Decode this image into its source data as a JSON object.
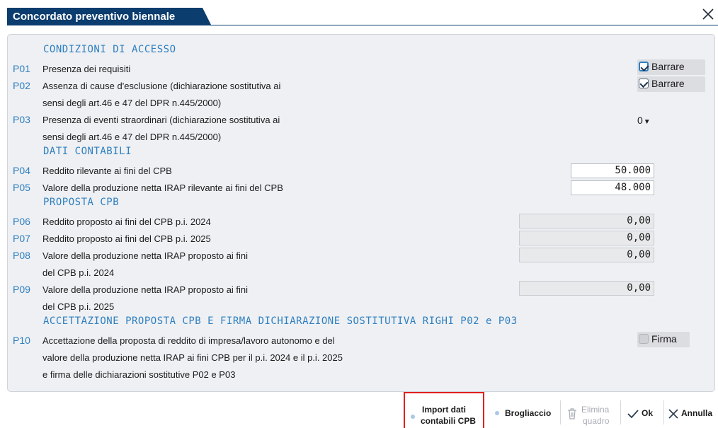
{
  "window": {
    "title": "Concordato preventivo biennale",
    "close_icon": "close-icon"
  },
  "sections": {
    "access": "CONDIZIONI DI ACCESSO",
    "accounting": "DATI CONTABILI",
    "proposal": "PROPOSTA CPB",
    "acceptance": "ACCETTAZIONE PROPOSTA CPB E FIRMA DICHIARAZIONE SOSTITUTIVA RIGHI P02 e P03"
  },
  "rows": {
    "p01": {
      "code": "P01",
      "label": "Presenza dei requisiti",
      "check_label": "Barrare",
      "checked": true
    },
    "p02": {
      "code": "P02",
      "label1": "Assenza di cause d'esclusione (dichiarazione sostitutiva ai",
      "label2": "sensi degli art.46 e 47 del DPR n.445/2000)",
      "check_label": "Barrare",
      "checked": true
    },
    "p03": {
      "code": "P03",
      "label1": "Presenza di eventi straordinari (dichiarazione sostitutiva ai",
      "label2": "sensi degli art.46 e 47 del DPR n.445/2000)",
      "value": "0"
    },
    "p04": {
      "code": "P04",
      "label": "Reddito rilevante ai fini del CPB",
      "value": "50.000"
    },
    "p05": {
      "code": "P05",
      "label": "Valore della produzione netta IRAP rilevante ai fini del CPB",
      "value": "48.000"
    },
    "p06": {
      "code": "P06",
      "label": "Reddito proposto ai fini del CPB p.i. 2024",
      "value": "0,00"
    },
    "p07": {
      "code": "P07",
      "label": "Reddito proposto ai fini del CPB p.i. 2025",
      "value": "0,00"
    },
    "p08": {
      "code": "P08",
      "label1": "Valore della produzione netta IRAP proposto ai fini",
      "label2": "del CPB p.i. 2024",
      "value": "0,00"
    },
    "p09": {
      "code": "P09",
      "label1": "Valore della produzione netta IRAP proposto ai fini",
      "label2": "del CPB p.i. 2025",
      "value": "0,00"
    },
    "p10": {
      "code": "P10",
      "label1": "Accettazione della proposta di reddito di impresa/lavoro autonomo e del",
      "label2": "valore della produzione netta IRAP ai fini CPB per il p.i. 2024 e il p.i. 2025",
      "label3": "e firma delle dichiarazioni sostitutive P02 e P03",
      "check_label": "Firma",
      "checked": false
    }
  },
  "toolbar": {
    "import_line1": "Import dati",
    "import_line2": "contabili CPB",
    "brogliaccio": "Brogliaccio",
    "elimina_line1": "Elimina",
    "elimina_line2": "quadro",
    "ok": "Ok",
    "annulla": "Annulla"
  },
  "colors": {
    "accent": "#0b3d6e",
    "code_blue": "#2f7fc0",
    "highlight": "#e0201f"
  }
}
